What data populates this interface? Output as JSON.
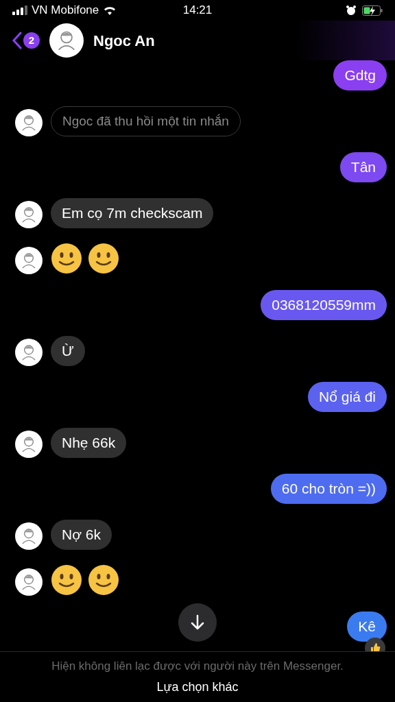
{
  "status_bar": {
    "carrier": "VN Mobifone",
    "time": "14:21"
  },
  "header": {
    "unread_count": "2",
    "contact_name": "Ngoc An"
  },
  "messages": [
    {
      "kind": "outgoing",
      "text": "Gdtg"
    },
    {
      "kind": "recalled",
      "text": "Ngoc đã thu hồi một tin nhắn"
    },
    {
      "kind": "outgoing",
      "text": "Tân"
    },
    {
      "kind": "incoming",
      "text": "Em cọ 7m checkscam"
    },
    {
      "kind": "smileys"
    },
    {
      "kind": "outgoing",
      "text": "0368120559mm"
    },
    {
      "kind": "incoming",
      "text": "Ừ"
    },
    {
      "kind": "outgoing",
      "text": "Nổ giá đi"
    },
    {
      "kind": "incoming",
      "text": "Nhẹ 66k"
    },
    {
      "kind": "outgoing",
      "text": "60 cho tròn =))"
    },
    {
      "kind": "incoming",
      "text": "Nợ 6k"
    },
    {
      "kind": "smileys"
    },
    {
      "kind": "outgoing",
      "text": "Kê",
      "liked": true
    }
  ],
  "footer": {
    "notice": "Hiện không liên lạc được với người này trên Messenger.",
    "action": "Lựa chọn khác"
  }
}
